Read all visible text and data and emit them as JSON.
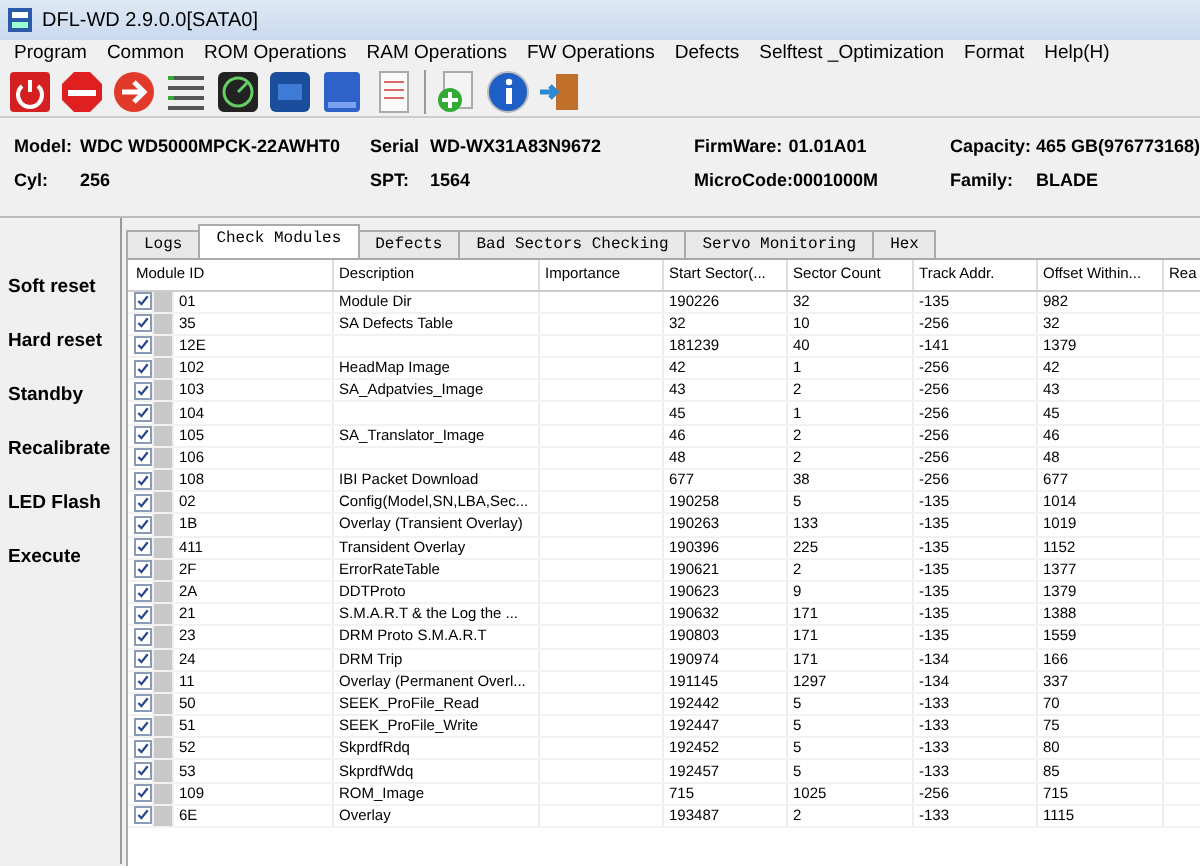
{
  "window": {
    "title": "DFL-WD 2.9.0.0[SATA0]"
  },
  "menu": [
    "Program",
    "Common",
    "ROM Operations",
    "RAM Operations",
    "FW Operations",
    "Defects",
    "Selftest _Optimization",
    "Format",
    "Help(H)"
  ],
  "toolbar": [
    {
      "kind": "power"
    },
    {
      "kind": "stop"
    },
    {
      "kind": "arrow"
    },
    {
      "kind": "list"
    },
    {
      "kind": "radar"
    },
    {
      "kind": "rom"
    },
    {
      "kind": "ram"
    },
    {
      "kind": "doc"
    },
    {
      "kind": "sep"
    },
    {
      "kind": "add"
    },
    {
      "kind": "info"
    },
    {
      "kind": "exit"
    }
  ],
  "drive_info": [
    [
      {
        "label": "Model:",
        "value": "WDC WD5000MPCK-22AWHT0"
      },
      {
        "label": "Serial",
        "value": "WD-WX31A83N9672"
      },
      {
        "label": "FirmWare:",
        "value": "01.01A01"
      },
      {
        "label": "Capacity:",
        "value": "465 GB(976773168)"
      }
    ],
    [
      {
        "label": "Cyl:",
        "value": "256"
      },
      {
        "label": "SPT:",
        "value": "1564"
      },
      {
        "label": "MicroCode:",
        "value": "0001000M"
      },
      {
        "label": "Family:",
        "value": "BLADE"
      }
    ]
  ],
  "sidebar": [
    "Soft reset",
    "Hard reset",
    "Standby",
    "Recalibrate",
    "LED Flash",
    "Execute"
  ],
  "tabs": [
    {
      "label": "Logs",
      "selected": false
    },
    {
      "label": "Check Modules",
      "selected": true
    },
    {
      "label": "Defects",
      "selected": false
    },
    {
      "label": "Bad Sectors Checking",
      "selected": false
    },
    {
      "label": "Servo Monitoring",
      "selected": false
    },
    {
      "label": "Hex",
      "selected": false
    }
  ],
  "table": {
    "columns": [
      "Module ID",
      "Description",
      "Importance",
      "Start Sector(...",
      "Sector Count",
      "Track Addr.",
      "Offset Within...",
      "Rea"
    ],
    "rows": [
      {
        "checked": true,
        "cells": [
          "01",
          "Module Dir",
          "",
          "190226",
          "32",
          "-135",
          "982"
        ]
      },
      {
        "checked": true,
        "cells": [
          "35",
          "SA Defects Table",
          "",
          "32",
          "10",
          "-256",
          "32"
        ]
      },
      {
        "checked": true,
        "cells": [
          "12E",
          "",
          "",
          "181239",
          "40",
          "-141",
          "1379"
        ]
      },
      {
        "checked": true,
        "cells": [
          "102",
          "HeadMap Image",
          "",
          "42",
          "1",
          "-256",
          "42"
        ]
      },
      {
        "checked": true,
        "cells": [
          "103",
          "SA_Adpatvies_Image",
          "",
          "43",
          "2",
          "-256",
          "43"
        ]
      },
      {
        "checked": true,
        "cells": [
          "104",
          "",
          "",
          "45",
          "1",
          "-256",
          "45"
        ]
      },
      {
        "checked": true,
        "cells": [
          "105",
          "SA_Translator_Image",
          "",
          "46",
          "2",
          "-256",
          "46"
        ]
      },
      {
        "checked": true,
        "cells": [
          "106",
          "",
          "",
          "48",
          "2",
          "-256",
          "48"
        ]
      },
      {
        "checked": true,
        "cells": [
          "108",
          "IBI Packet Download",
          "",
          "677",
          "38",
          "-256",
          "677"
        ]
      },
      {
        "checked": true,
        "cells": [
          "02",
          "Config(Model,SN,LBA,Sec...",
          "",
          "190258",
          "5",
          "-135",
          "1014"
        ]
      },
      {
        "checked": true,
        "cells": [
          "1B",
          "Overlay (Transient Overlay)",
          "",
          "190263",
          "133",
          "-135",
          "1019"
        ]
      },
      {
        "checked": true,
        "cells": [
          "411",
          "Transident Overlay",
          "",
          "190396",
          "225",
          "-135",
          "1152"
        ]
      },
      {
        "checked": true,
        "cells": [
          "2F",
          "ErrorRateTable",
          "",
          "190621",
          "2",
          "-135",
          "1377"
        ]
      },
      {
        "checked": true,
        "cells": [
          "2A",
          "DDTProto",
          "",
          "190623",
          "9",
          "-135",
          "1379"
        ]
      },
      {
        "checked": true,
        "cells": [
          "21",
          "S.M.A.R.T & the Log the ...",
          "",
          "190632",
          "171",
          "-135",
          "1388"
        ]
      },
      {
        "checked": true,
        "cells": [
          "23",
          "DRM Proto S.M.A.R.T",
          "",
          "190803",
          "171",
          "-135",
          "1559"
        ]
      },
      {
        "checked": true,
        "cells": [
          "24",
          "DRM Trip",
          "",
          "190974",
          "171",
          "-134",
          "166"
        ]
      },
      {
        "checked": true,
        "cells": [
          "11",
          "Overlay (Permanent Overl...",
          "",
          "191145",
          "1297",
          "-134",
          "337"
        ]
      },
      {
        "checked": true,
        "cells": [
          "50",
          "SEEK_ProFile_Read",
          "",
          "192442",
          "5",
          "-133",
          "70"
        ]
      },
      {
        "checked": true,
        "cells": [
          "51",
          "SEEK_ProFile_Write",
          "",
          "192447",
          "5",
          "-133",
          "75"
        ]
      },
      {
        "checked": true,
        "cells": [
          "52",
          "SkprdfRdq",
          "",
          "192452",
          "5",
          "-133",
          "80"
        ]
      },
      {
        "checked": true,
        "cells": [
          "53",
          "SkprdfWdq",
          "",
          "192457",
          "5",
          "-133",
          "85"
        ]
      },
      {
        "checked": true,
        "cells": [
          "109",
          "ROM_Image",
          "",
          "715",
          "1025",
          "-256",
          "715"
        ]
      },
      {
        "checked": true,
        "cells": [
          "6E",
          "Overlay",
          "",
          "193487",
          "2",
          "-133",
          "1115"
        ]
      }
    ]
  }
}
